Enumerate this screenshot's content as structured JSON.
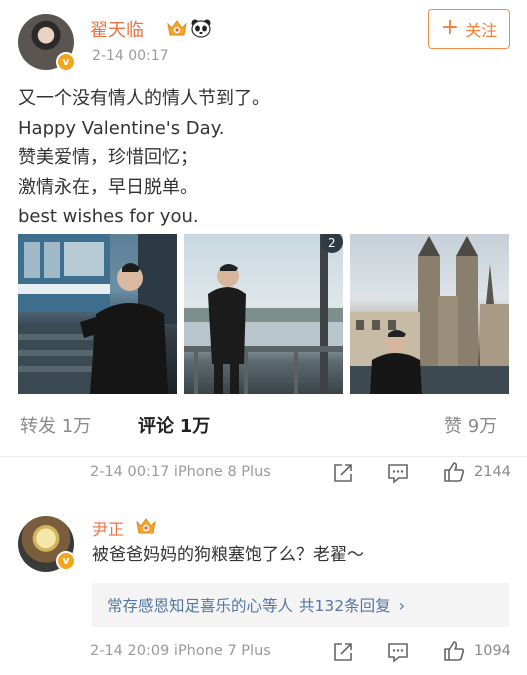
{
  "post": {
    "username": "翟天临",
    "timestamp": "2-14 00:17",
    "follow_label": "关注",
    "lines": [
      "又一个没有情人的情人节到了。",
      "Happy Valentine's Day.",
      "赞美爱情，珍惜回忆；",
      "激情永在，早日脱单。",
      "best wishes for you."
    ]
  },
  "actions": {
    "repost_label": "转发",
    "repost_count": "1万",
    "comment_label": "评论",
    "comment_count": "1万",
    "like_label": "赞",
    "like_count": "9万"
  },
  "post_meta": {
    "time_device": "2-14 00:17 iPhone 8 Plus",
    "likes": "2144"
  },
  "comment": {
    "username": "尹正",
    "text": "被爸爸妈妈的狗粮塞饱了么？老翟～",
    "reply_summary": "常存感恩知足喜乐的心等人",
    "reply_count": "共132条回复",
    "time_device": "2-14 20:09 iPhone 7 Plus",
    "likes": "1094"
  },
  "colors": {
    "username": "#eb7340",
    "follow_accent": "#f08035",
    "link_blue": "#5576a0",
    "muted": "#9a9a9a"
  },
  "icons": [
    "crown-badge-icon",
    "panda-icon",
    "verified-v-icon",
    "plus-icon",
    "share-icon",
    "comment-icon",
    "thumbs-up-icon",
    "chevron-right-icon"
  ]
}
